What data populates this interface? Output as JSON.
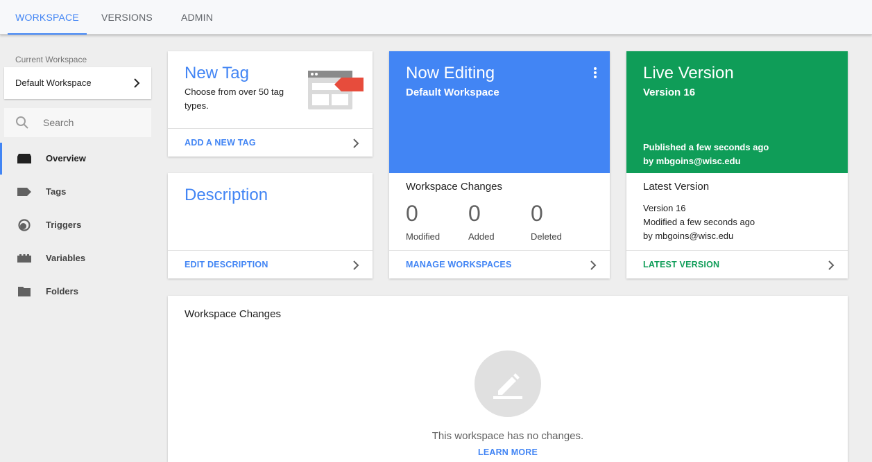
{
  "topnav": {
    "tabs": [
      {
        "label": "WORKSPACE",
        "active": true
      },
      {
        "label": "VERSIONS",
        "active": false
      },
      {
        "label": "ADMIN",
        "active": false
      }
    ]
  },
  "sidebar": {
    "current_workspace_label": "Current Workspace",
    "workspace_name": "Default Workspace",
    "search_placeholder": "Search",
    "items": [
      {
        "label": "Overview",
        "icon": "overview-icon",
        "active": true
      },
      {
        "label": "Tags",
        "icon": "tag-icon",
        "active": false
      },
      {
        "label": "Triggers",
        "icon": "trigger-icon",
        "active": false
      },
      {
        "label": "Variables",
        "icon": "variable-icon",
        "active": false
      },
      {
        "label": "Folders",
        "icon": "folder-icon",
        "active": false
      }
    ]
  },
  "new_tag": {
    "title": "New Tag",
    "description": "Choose from over 50 tag types.",
    "link": "ADD A NEW TAG"
  },
  "description_card": {
    "title": "Description",
    "link": "EDIT DESCRIPTION"
  },
  "now_editing": {
    "title": "Now Editing",
    "workspace": "Default Workspace",
    "changes_title": "Workspace Changes",
    "stats": [
      {
        "value": "0",
        "label": "Modified"
      },
      {
        "value": "0",
        "label": "Added"
      },
      {
        "value": "0",
        "label": "Deleted"
      }
    ],
    "link": "MANAGE WORKSPACES"
  },
  "live_version": {
    "title": "Live Version",
    "version": "Version 16",
    "published": "Published a few seconds ago",
    "published_by": "by mbgoins@wisc.edu",
    "latest_title": "Latest Version",
    "latest_version": "Version 16",
    "latest_modified": "Modified a few seconds ago",
    "latest_by": "by mbgoins@wisc.edu",
    "link": "LATEST VERSION"
  },
  "workspace_changes": {
    "title": "Workspace Changes",
    "empty_message": "This workspace has no changes.",
    "link": "LEARN MORE"
  },
  "colors": {
    "accent_blue": "#4285f4",
    "live_green": "#0f9d58",
    "tag_red": "#e74c3c"
  }
}
